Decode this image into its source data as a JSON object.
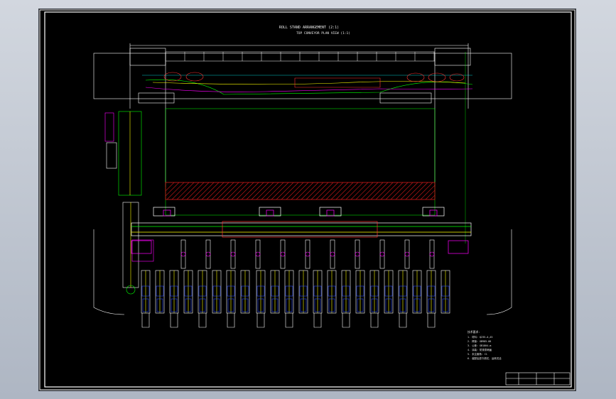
{
  "drawing": {
    "title_line_1": "ROLL STAND ARRANGEMENT (2:1)",
    "title_line_2": "TOP CONVEYOR PLAN VIEW (1:1)"
  },
  "notes": {
    "heading": "技术要求:",
    "lines": [
      "1. 材料: Q235-A,45",
      "2. 焊接: GB985-88",
      "3. 公差: GB1804-m",
      "4. 涂装: 防锈漆两遍",
      "5. 未注倒角: C1",
      "6. 装配后进行调试, 运转灵活"
    ]
  },
  "colors": {
    "sheet": "#000000",
    "frame": "#ffffff",
    "structure": "#ffffff",
    "conveyor": "#00ff00",
    "accent": "#ff00ff",
    "hatch": "#d11a1a",
    "roller": "#2a4bff",
    "yellow": "#ffff00",
    "red": "#ff3333",
    "cyan": "#00ffff"
  }
}
